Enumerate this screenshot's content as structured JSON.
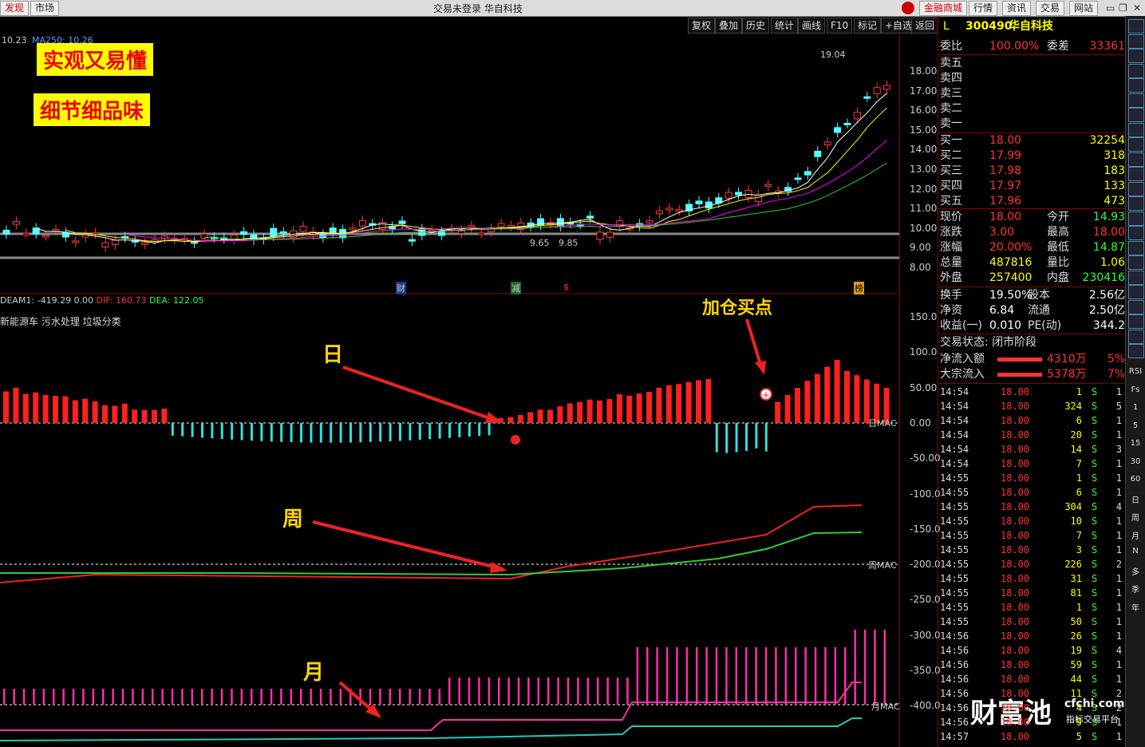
{
  "topbar": {
    "left_buttons": [
      "发现",
      "市场"
    ],
    "title": "交易未登录",
    "stock_name_title": "华自科技",
    "right_buttons": [
      "金融商城",
      "行情",
      "资讯",
      "交易",
      "网站"
    ]
  },
  "toolbar": [
    "复权",
    "叠加",
    "历史",
    "统计",
    "画线",
    "F10",
    "标记",
    "+自选",
    "返回"
  ],
  "chart": {
    "ma_label": "10.23",
    "ma_legend": "MA250: 10.26",
    "high_label": "19.04",
    "low_label1": "9.65",
    "low_label2": "9.85",
    "price_axis": [
      "18.00",
      "17.00",
      "16.00",
      "15.00",
      "14.00",
      "13.00",
      "12.00",
      "11.00",
      "10.00",
      "9.00",
      "8.00"
    ],
    "event_markers": [
      "财",
      "减",
      "$",
      "榜"
    ],
    "macd_header": {
      "deam": "DEAM1: -419.29",
      "zero": "0.00",
      "dif": "DIF: 160.73",
      "dea": "DEA: 122.05"
    },
    "concepts": "新能源车 污水处理 垃圾分类",
    "macd_axis": [
      "150.0",
      "100.0",
      "50.00",
      "0.00",
      "-50.00",
      "-100.0",
      "-150.0",
      "-200.0",
      "-250.0",
      "-300.0",
      "-350.0",
      "-400.0"
    ],
    "line_labels": [
      "日MAC",
      "周MAC",
      "月MAC"
    ],
    "overlay_boxes": [
      "实观又易懂",
      "细节细品味"
    ],
    "annotations": {
      "day": "日",
      "week": "周",
      "month": "月",
      "add": "加仓买点"
    },
    "watermark": "财富池",
    "watermark_site": "cfchi.com",
    "watermark_sub": "指标交易平台"
  },
  "quote": {
    "code": "300490",
    "name": "华自科技",
    "prefix": "L",
    "weibi_label": "委比",
    "weibi": "100.00%",
    "weicha_label": "委差",
    "weicha": "33361",
    "sell": [
      {
        "label": "卖五"
      },
      {
        "label": "卖四"
      },
      {
        "label": "卖三"
      },
      {
        "label": "卖二"
      },
      {
        "label": "卖一"
      }
    ],
    "buy": [
      {
        "label": "买一",
        "price": "18.00",
        "vol": "32254"
      },
      {
        "label": "买二",
        "price": "17.99",
        "vol": "318"
      },
      {
        "label": "买三",
        "price": "17.98",
        "vol": "183"
      },
      {
        "label": "买四",
        "price": "17.97",
        "vol": "133"
      },
      {
        "label": "买五",
        "price": "17.96",
        "vol": "473"
      }
    ],
    "stats": [
      {
        "l1": "现价",
        "v1": "18.00",
        "l2": "今开",
        "v2": "14.93",
        "c2": "#3f3"
      },
      {
        "l1": "涨跌",
        "v1": "3.00",
        "l2": "最高",
        "v2": "18.00",
        "c2": "#f33"
      },
      {
        "l1": "涨幅",
        "v1": "20.00%",
        "l2": "最低",
        "v2": "14.87",
        "c2": "#3f3"
      },
      {
        "l1": "总量",
        "v1": "487816",
        "l2": "量比",
        "v2": "1.06",
        "c2": "#ff0"
      },
      {
        "l1": "外盘",
        "v1": "257400",
        "l2": "内盘",
        "v2": "230416",
        "c2": "#3f3"
      }
    ],
    "stats2": [
      {
        "l1": "换手",
        "v1": "19.50%",
        "l2": "股本",
        "v2": "2.56亿"
      },
      {
        "l1": "净资",
        "v1": "6.84",
        "l2": "流通",
        "v2": "2.50亿"
      },
      {
        "l1": "收益(一)",
        "v1": "0.010",
        "l2": "PE(动)",
        "v2": "344.2"
      }
    ],
    "trade_status": "交易状态: 闭市阶段",
    "flow": [
      {
        "label": "净流入额",
        "amount": "4310万",
        "pct": "5%"
      },
      {
        "label": "大宗流入",
        "amount": "5378万",
        "pct": "7%"
      }
    ],
    "ticks": [
      {
        "t": "14:54",
        "p": "18.00",
        "v": "1",
        "s": "S",
        "n": "1"
      },
      {
        "t": "14:54",
        "p": "18.00",
        "v": "324",
        "s": "S",
        "n": "5"
      },
      {
        "t": "14:54",
        "p": "18.00",
        "v": "6",
        "s": "S",
        "n": "1"
      },
      {
        "t": "14:54",
        "p": "18.00",
        "v": "20",
        "s": "S",
        "n": "1"
      },
      {
        "t": "14:54",
        "p": "18.00",
        "v": "14",
        "s": "S",
        "n": "3"
      },
      {
        "t": "14:54",
        "p": "18.00",
        "v": "7",
        "s": "S",
        "n": "1"
      },
      {
        "t": "14:55",
        "p": "18.00",
        "v": "1",
        "s": "S",
        "n": "1"
      },
      {
        "t": "14:55",
        "p": "18.00",
        "v": "6",
        "s": "S",
        "n": "1"
      },
      {
        "t": "14:55",
        "p": "18.00",
        "v": "304",
        "s": "S",
        "n": "4"
      },
      {
        "t": "14:55",
        "p": "18.00",
        "v": "10",
        "s": "S",
        "n": "1"
      },
      {
        "t": "14:55",
        "p": "18.00",
        "v": "7",
        "s": "S",
        "n": "1"
      },
      {
        "t": "14:55",
        "p": "18.00",
        "v": "3",
        "s": "S",
        "n": "1"
      },
      {
        "t": "14:55",
        "p": "18.00",
        "v": "226",
        "s": "S",
        "n": "2"
      },
      {
        "t": "14:55",
        "p": "18.00",
        "v": "31",
        "s": "S",
        "n": "1"
      },
      {
        "t": "14:55",
        "p": "18.00",
        "v": "81",
        "s": "S",
        "n": "1"
      },
      {
        "t": "14:55",
        "p": "18.00",
        "v": "1",
        "s": "S",
        "n": "1"
      },
      {
        "t": "14:55",
        "p": "18.00",
        "v": "50",
        "s": "S",
        "n": "1"
      },
      {
        "t": "14:56",
        "p": "18.00",
        "v": "26",
        "s": "S",
        "n": "1"
      },
      {
        "t": "14:56",
        "p": "18.00",
        "v": "19",
        "s": "S",
        "n": "4"
      },
      {
        "t": "14:56",
        "p": "18.00",
        "v": "59",
        "s": "S",
        "n": "1"
      },
      {
        "t": "14:56",
        "p": "18.00",
        "v": "44",
        "s": "S",
        "n": "1"
      },
      {
        "t": "14:56",
        "p": "18.00",
        "v": "11",
        "s": "S",
        "n": "2"
      },
      {
        "t": "14:56",
        "p": "18.00",
        "v": "4",
        "s": "S",
        "n": "2"
      },
      {
        "t": "14:56",
        "p": "18.00",
        "v": "9",
        "s": "S",
        "n": "1"
      },
      {
        "t": "14:57",
        "p": "18.00",
        "v": "5",
        "s": "S",
        "n": "1"
      }
    ]
  },
  "side_icons": [
    "arrow-left-icon",
    "arrow-right-icon",
    "grid-icon",
    "chart-icon",
    "doc-icon",
    "bars-icon",
    "trend-icon",
    "candles-icon",
    "rank-icon",
    "list-icon",
    "table-icon",
    "f1-icon",
    "fz-icon",
    "gear-icon",
    "circle-icon",
    "rsi-icon",
    "wave-icon",
    "stack-icon",
    "x-icon",
    "move-icon",
    "pen-icon",
    "fs-icon",
    "b-icon"
  ],
  "side_labels": [
    "RSI",
    "Fs",
    "1",
    "5",
    "15",
    "30",
    "60",
    "日",
    "周",
    "月",
    "N",
    "多",
    "季",
    "年"
  ]
}
